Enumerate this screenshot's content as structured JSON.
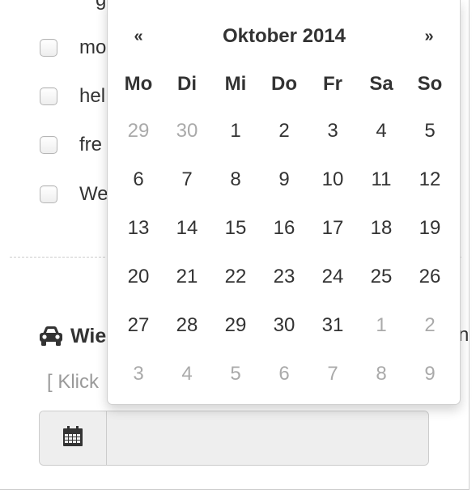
{
  "form": {
    "cut_top_text": "g",
    "checkbox_items": [
      {
        "label": "mo"
      },
      {
        "label": "hel"
      },
      {
        "label": "fre"
      },
      {
        "label": "We"
      }
    ],
    "section_heading": "Wie",
    "heading_cut_right": "n",
    "hint": "[ Klick",
    "date_value": "",
    "icons": {
      "section": "car-icon",
      "addon": "calendar-icon"
    }
  },
  "datepicker": {
    "prev": "«",
    "next": "»",
    "title": "Oktober 2014",
    "weekdays": [
      "Mo",
      "Di",
      "Mi",
      "Do",
      "Fr",
      "Sa",
      "So"
    ],
    "weeks": [
      [
        {
          "d": "29",
          "muted": true
        },
        {
          "d": "30",
          "muted": true
        },
        {
          "d": "1"
        },
        {
          "d": "2"
        },
        {
          "d": "3"
        },
        {
          "d": "4"
        },
        {
          "d": "5"
        }
      ],
      [
        {
          "d": "6"
        },
        {
          "d": "7"
        },
        {
          "d": "8"
        },
        {
          "d": "9"
        },
        {
          "d": "10"
        },
        {
          "d": "11"
        },
        {
          "d": "12"
        }
      ],
      [
        {
          "d": "13"
        },
        {
          "d": "14"
        },
        {
          "d": "15"
        },
        {
          "d": "16"
        },
        {
          "d": "17"
        },
        {
          "d": "18"
        },
        {
          "d": "19"
        }
      ],
      [
        {
          "d": "20"
        },
        {
          "d": "21"
        },
        {
          "d": "22"
        },
        {
          "d": "23"
        },
        {
          "d": "24"
        },
        {
          "d": "25"
        },
        {
          "d": "26"
        }
      ],
      [
        {
          "d": "27"
        },
        {
          "d": "28"
        },
        {
          "d": "29"
        },
        {
          "d": "30"
        },
        {
          "d": "31"
        },
        {
          "d": "1",
          "muted": true
        },
        {
          "d": "2",
          "muted": true
        }
      ],
      [
        {
          "d": "3",
          "muted": true
        },
        {
          "d": "4",
          "muted": true
        },
        {
          "d": "5",
          "muted": true
        },
        {
          "d": "6",
          "muted": true
        },
        {
          "d": "7",
          "muted": true
        },
        {
          "d": "8",
          "muted": true
        },
        {
          "d": "9",
          "muted": true
        }
      ]
    ]
  },
  "colors": {
    "text": "#333333",
    "muted_day": "#aaaaaa",
    "hint": "#9a9a9a",
    "input_bg": "#eeeeee"
  }
}
